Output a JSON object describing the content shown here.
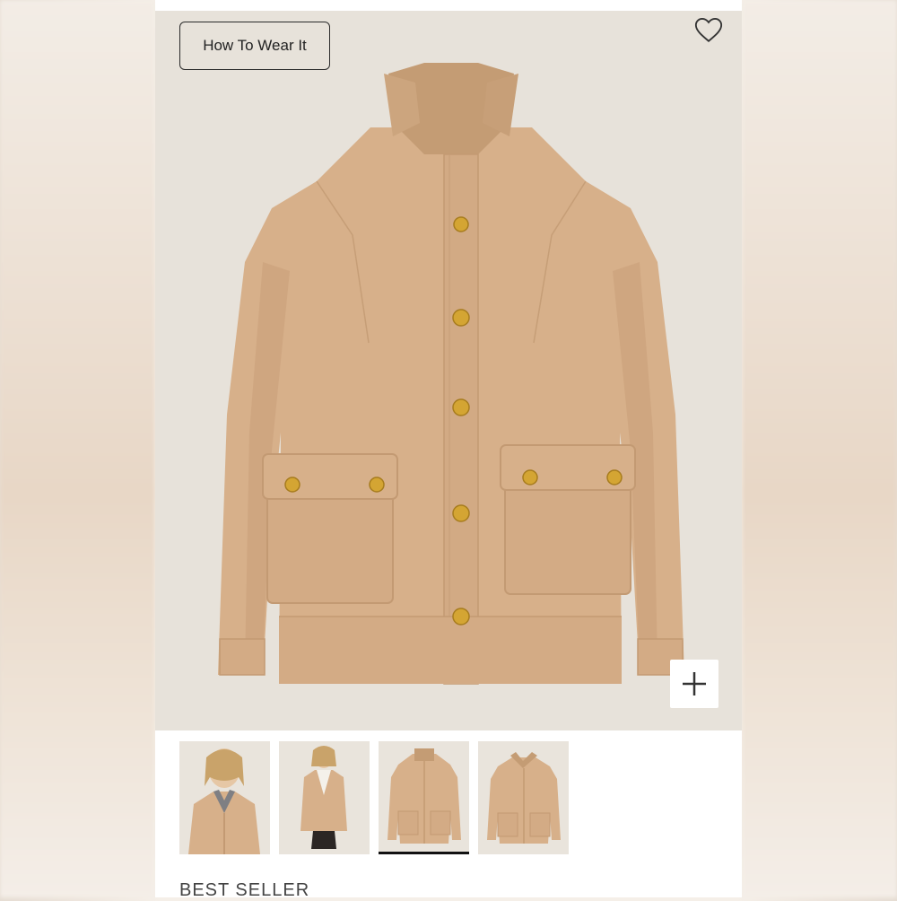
{
  "hero": {
    "how_to_wear_label": "How To Wear It",
    "favorite_icon": "heart-icon",
    "zoom_icon": "plus-icon",
    "image_alt": "Camel wool jacket with stand collar, gold buttons and flap pockets"
  },
  "thumbnails": [
    {
      "name": "model-front-closeup",
      "active": false
    },
    {
      "name": "model-full-outfit",
      "active": false
    },
    {
      "name": "product-front",
      "active": true
    },
    {
      "name": "product-front-collar-down",
      "active": false
    }
  ],
  "product": {
    "badge": "BEST SELLER"
  },
  "colors": {
    "coat": "#d7b08a",
    "coat_dark": "#c59d76",
    "button_gold": "#d4a533",
    "hero_bg": "#e7e2da"
  }
}
